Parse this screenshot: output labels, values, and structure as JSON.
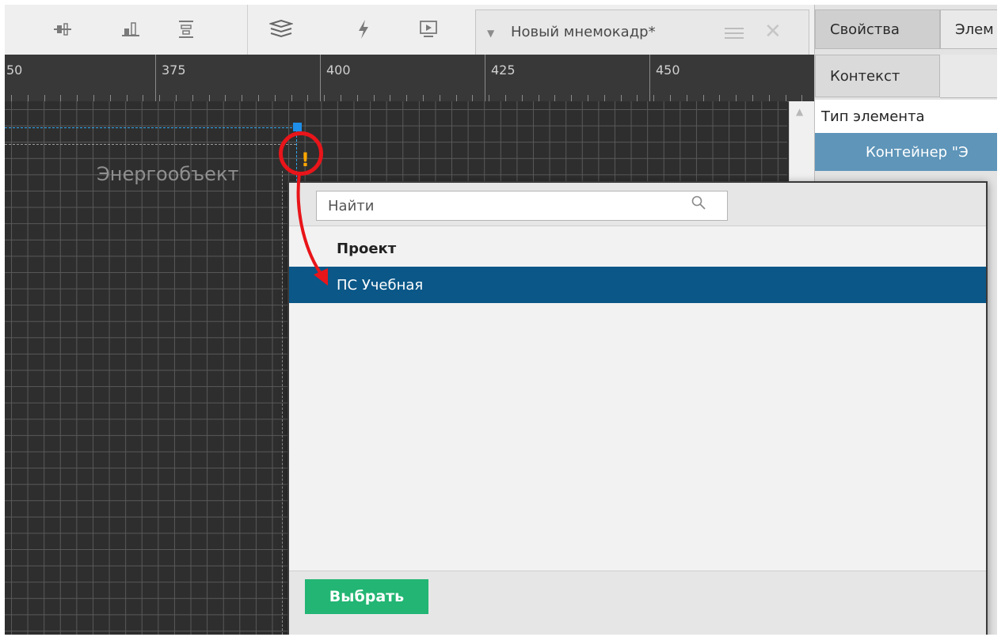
{
  "toolbar": {
    "icons": [
      "align-center-icon",
      "align-bottom-icon",
      "distribute-icon",
      "layers-icon",
      "lightning-icon",
      "play-screen-icon"
    ]
  },
  "tab": {
    "title": "Новый мнемокадр*"
  },
  "ruler": {
    "labels": [
      "50",
      "375",
      "400",
      "425",
      "450"
    ]
  },
  "canvas": {
    "element_label": "Энергообъект",
    "warning_mark": "!"
  },
  "right_panel": {
    "tab_properties": "Свойства",
    "tab_elements": "Элем",
    "tab_context": "Контекст",
    "element_type_label": "Тип элемента",
    "element_type_value": "Контейнер \"Э"
  },
  "popup": {
    "search_placeholder": "Найти",
    "group_label": "Проект",
    "items": [
      "ПС Учебная"
    ],
    "select_button": "Выбрать"
  },
  "colors": {
    "selected_row": "#0a5788",
    "select_button": "#22b573",
    "annotation": "#e8151a",
    "guide": "#2fa8f0",
    "warning": "#ffa600"
  }
}
